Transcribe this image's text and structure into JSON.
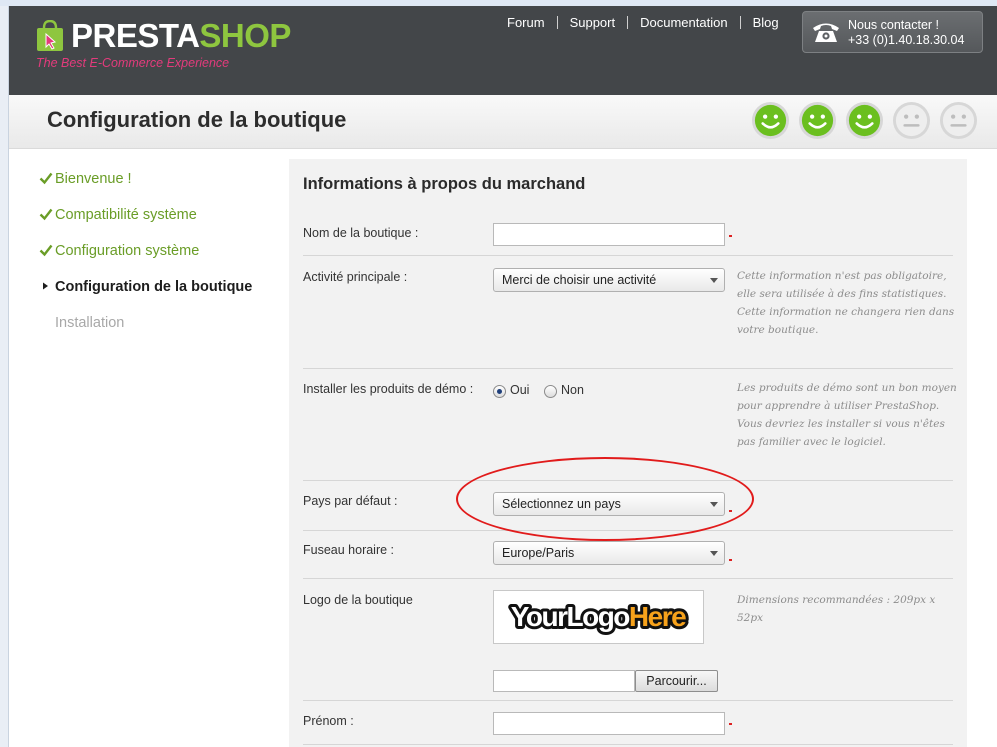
{
  "header": {
    "brand_presta": "PRESTA",
    "brand_shop": "SHOP",
    "tagline": "The Best E-Commerce Experience",
    "nav": [
      "Forum",
      "Support",
      "Documentation",
      "Blog"
    ],
    "contact_title": "Nous contacter !",
    "contact_phone": "+33 (0)1.40.18.30.04"
  },
  "title": "Configuration de la boutique",
  "progress": {
    "completed_steps": 3,
    "total_steps": 5
  },
  "steps": [
    {
      "label": "Bienvenue !",
      "state": "done"
    },
    {
      "label": "Compatibilité système",
      "state": "done"
    },
    {
      "label": "Configuration système",
      "state": "done"
    },
    {
      "label": "Configuration de la boutique",
      "state": "current"
    },
    {
      "label": "Installation",
      "state": "future"
    }
  ],
  "form": {
    "heading": "Informations à propos du marchand",
    "shop_name": {
      "label": "Nom de la boutique :",
      "value": ""
    },
    "activity": {
      "label": "Activité principale :",
      "value": "Merci de choisir une activité",
      "help": "Cette information n'est pas obligatoire, elle sera utilisée à des fins statistiques. Cette information ne changera rien dans votre boutique."
    },
    "demo": {
      "label": "Installer les produits de démo :",
      "yes": "Oui",
      "no": "Non",
      "selected": "yes",
      "help": "Les produits de démo sont un bon moyen pour apprendre à utiliser PrestaShop. Vous devriez les installer si vous n'êtes pas familier avec le logiciel."
    },
    "country": {
      "label": "Pays par défaut :",
      "value": "Sélectionnez un pays"
    },
    "timezone": {
      "label": "Fuseau horaire :",
      "value": "Europe/Paris"
    },
    "logo": {
      "label": "Logo de la boutique",
      "image_text": "YourLogoHere",
      "help": "Dimensions recommandées : 209px x 52px",
      "browse": "Parcourir..."
    },
    "firstname": {
      "label": "Prénom :",
      "value": ""
    }
  },
  "colors": {
    "header_bg": "#434649",
    "accent_green": "#8ec63f",
    "done_green": "#6a9d27",
    "tagline_pink": "#e33b7c",
    "required_red": "#dd2222",
    "highlight_red": "#e11b1b"
  },
  "icons": {
    "logo": "prestashop-bag-icon",
    "phone": "phone-icon",
    "done": "check-icon",
    "current": "triangle-right-icon",
    "smiley_done": "green-smiley-icon",
    "smiley_todo": "gray-smiley-icon"
  }
}
